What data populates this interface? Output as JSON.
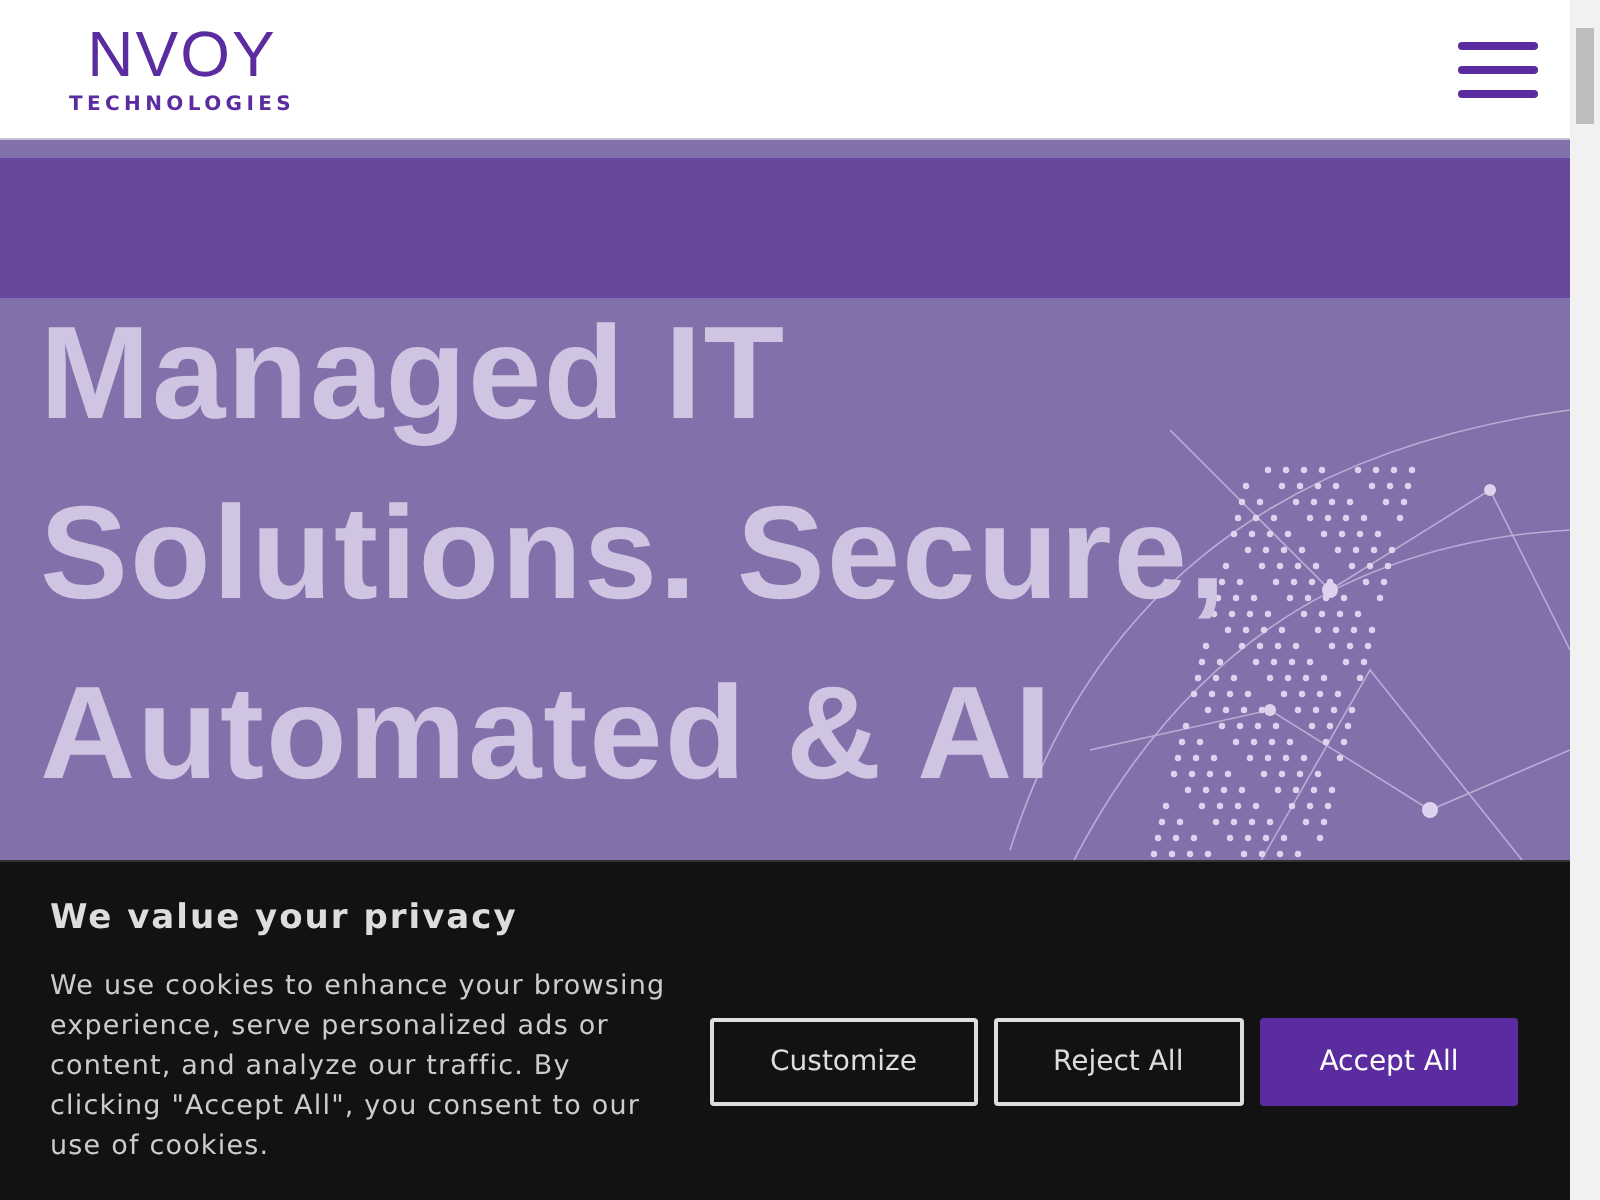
{
  "header": {
    "logo": {
      "name": "NVOY",
      "tagline": "TECHNOLOGIES"
    }
  },
  "hero": {
    "headline_lines": [
      "Managed IT",
      "Solutions. Secure,",
      "Automated & AI"
    ]
  },
  "cookie_banner": {
    "title": "We value your privacy",
    "text": "We use cookies to enhance your browsing experience, serve personalized ads or content, and analyze our traffic. By clicking \"Accept All\", you consent to our use of cookies.",
    "buttons": [
      {
        "label": "Customize",
        "kind": "outline"
      },
      {
        "label": "Reject All",
        "kind": "outline"
      },
      {
        "label": "Accept All",
        "kind": "primary"
      }
    ]
  }
}
